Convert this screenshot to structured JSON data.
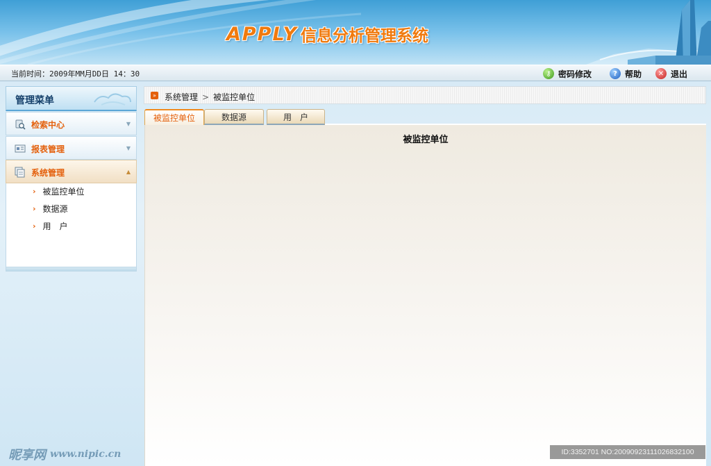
{
  "app": {
    "brand": "APPLY",
    "system_name": "信息分析管理系统"
  },
  "topbar": {
    "time_label": "当前时间：",
    "time_value": "2009年MM月DD日 14：30",
    "buttons": [
      {
        "label": "密码修改",
        "icon": "key-icon"
      },
      {
        "label": "帮助",
        "icon": "help-icon"
      },
      {
        "label": "退出",
        "icon": "exit-icon"
      }
    ]
  },
  "sidebar": {
    "title": "管理菜单",
    "groups": [
      {
        "label": "检索中心",
        "icon": "search-database-icon",
        "expanded": false
      },
      {
        "label": "报表管理",
        "icon": "report-icon",
        "expanded": false
      },
      {
        "label": "系统管理",
        "icon": "system-icon",
        "expanded": true
      }
    ],
    "sub_items": [
      {
        "label": "被监控单位"
      },
      {
        "label": "数据源"
      },
      {
        "label": "用　户"
      }
    ]
  },
  "breadcrumb": {
    "items": [
      "系统管理",
      "被监控单位"
    ],
    "separator": ">"
  },
  "tabs": [
    {
      "label": "被监控单位",
      "active": true
    },
    {
      "label": "数据源",
      "active": false
    },
    {
      "label": "用　户",
      "active": false
    }
  ],
  "panel": {
    "title": "被监控单位"
  },
  "watermark": {
    "left_text": "昵享网",
    "left_url": "www.nipic.cn",
    "right_text": "ID:3352701 NO:20090923111026832100"
  },
  "colors": {
    "accent_orange": "#e4600c",
    "banner_blue": "#3f9fd6",
    "nav_dark_blue": "#16416b"
  }
}
